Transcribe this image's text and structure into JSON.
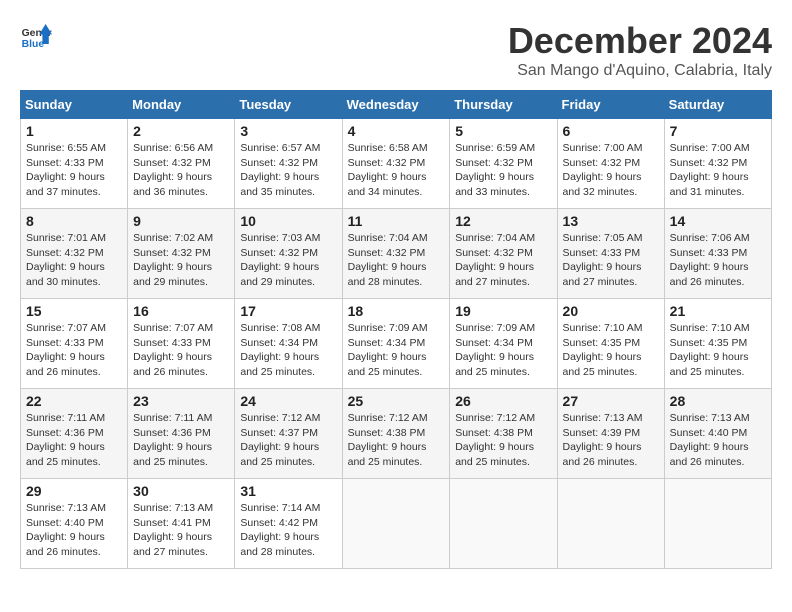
{
  "logo": {
    "general": "General",
    "blue": "Blue"
  },
  "title": {
    "month": "December 2024",
    "location": "San Mango d'Aquino, Calabria, Italy"
  },
  "weekdays": [
    "Sunday",
    "Monday",
    "Tuesday",
    "Wednesday",
    "Thursday",
    "Friday",
    "Saturday"
  ],
  "weeks": [
    [
      {
        "day": "1",
        "sunrise": "6:55 AM",
        "sunset": "4:33 PM",
        "daylight": "9 hours and 37 minutes."
      },
      {
        "day": "2",
        "sunrise": "6:56 AM",
        "sunset": "4:32 PM",
        "daylight": "9 hours and 36 minutes."
      },
      {
        "day": "3",
        "sunrise": "6:57 AM",
        "sunset": "4:32 PM",
        "daylight": "9 hours and 35 minutes."
      },
      {
        "day": "4",
        "sunrise": "6:58 AM",
        "sunset": "4:32 PM",
        "daylight": "9 hours and 34 minutes."
      },
      {
        "day": "5",
        "sunrise": "6:59 AM",
        "sunset": "4:32 PM",
        "daylight": "9 hours and 33 minutes."
      },
      {
        "day": "6",
        "sunrise": "7:00 AM",
        "sunset": "4:32 PM",
        "daylight": "9 hours and 32 minutes."
      },
      {
        "day": "7",
        "sunrise": "7:00 AM",
        "sunset": "4:32 PM",
        "daylight": "9 hours and 31 minutes."
      }
    ],
    [
      {
        "day": "8",
        "sunrise": "7:01 AM",
        "sunset": "4:32 PM",
        "daylight": "9 hours and 30 minutes."
      },
      {
        "day": "9",
        "sunrise": "7:02 AM",
        "sunset": "4:32 PM",
        "daylight": "9 hours and 29 minutes."
      },
      {
        "day": "10",
        "sunrise": "7:03 AM",
        "sunset": "4:32 PM",
        "daylight": "9 hours and 29 minutes."
      },
      {
        "day": "11",
        "sunrise": "7:04 AM",
        "sunset": "4:32 PM",
        "daylight": "9 hours and 28 minutes."
      },
      {
        "day": "12",
        "sunrise": "7:04 AM",
        "sunset": "4:32 PM",
        "daylight": "9 hours and 27 minutes."
      },
      {
        "day": "13",
        "sunrise": "7:05 AM",
        "sunset": "4:33 PM",
        "daylight": "9 hours and 27 minutes."
      },
      {
        "day": "14",
        "sunrise": "7:06 AM",
        "sunset": "4:33 PM",
        "daylight": "9 hours and 26 minutes."
      }
    ],
    [
      {
        "day": "15",
        "sunrise": "7:07 AM",
        "sunset": "4:33 PM",
        "daylight": "9 hours and 26 minutes."
      },
      {
        "day": "16",
        "sunrise": "7:07 AM",
        "sunset": "4:33 PM",
        "daylight": "9 hours and 26 minutes."
      },
      {
        "day": "17",
        "sunrise": "7:08 AM",
        "sunset": "4:34 PM",
        "daylight": "9 hours and 25 minutes."
      },
      {
        "day": "18",
        "sunrise": "7:09 AM",
        "sunset": "4:34 PM",
        "daylight": "9 hours and 25 minutes."
      },
      {
        "day": "19",
        "sunrise": "7:09 AM",
        "sunset": "4:34 PM",
        "daylight": "9 hours and 25 minutes."
      },
      {
        "day": "20",
        "sunrise": "7:10 AM",
        "sunset": "4:35 PM",
        "daylight": "9 hours and 25 minutes."
      },
      {
        "day": "21",
        "sunrise": "7:10 AM",
        "sunset": "4:35 PM",
        "daylight": "9 hours and 25 minutes."
      }
    ],
    [
      {
        "day": "22",
        "sunrise": "7:11 AM",
        "sunset": "4:36 PM",
        "daylight": "9 hours and 25 minutes."
      },
      {
        "day": "23",
        "sunrise": "7:11 AM",
        "sunset": "4:36 PM",
        "daylight": "9 hours and 25 minutes."
      },
      {
        "day": "24",
        "sunrise": "7:12 AM",
        "sunset": "4:37 PM",
        "daylight": "9 hours and 25 minutes."
      },
      {
        "day": "25",
        "sunrise": "7:12 AM",
        "sunset": "4:38 PM",
        "daylight": "9 hours and 25 minutes."
      },
      {
        "day": "26",
        "sunrise": "7:12 AM",
        "sunset": "4:38 PM",
        "daylight": "9 hours and 25 minutes."
      },
      {
        "day": "27",
        "sunrise": "7:13 AM",
        "sunset": "4:39 PM",
        "daylight": "9 hours and 26 minutes."
      },
      {
        "day": "28",
        "sunrise": "7:13 AM",
        "sunset": "4:40 PM",
        "daylight": "9 hours and 26 minutes."
      }
    ],
    [
      {
        "day": "29",
        "sunrise": "7:13 AM",
        "sunset": "4:40 PM",
        "daylight": "9 hours and 26 minutes."
      },
      {
        "day": "30",
        "sunrise": "7:13 AM",
        "sunset": "4:41 PM",
        "daylight": "9 hours and 27 minutes."
      },
      {
        "day": "31",
        "sunrise": "7:14 AM",
        "sunset": "4:42 PM",
        "daylight": "9 hours and 28 minutes."
      },
      null,
      null,
      null,
      null
    ]
  ]
}
